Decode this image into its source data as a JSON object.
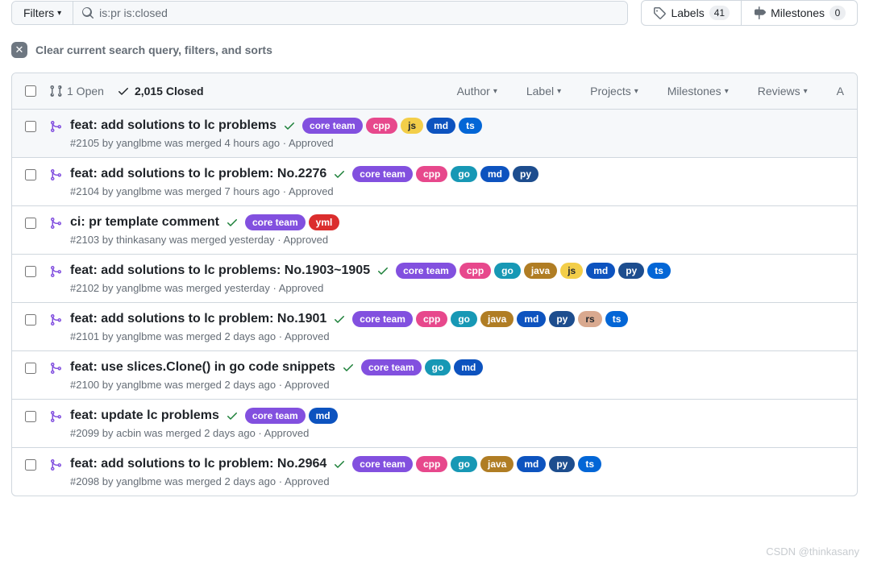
{
  "topbar": {
    "filters_label": "Filters",
    "search_value": "is:pr is:closed",
    "labels_btn": "Labels",
    "labels_count": "41",
    "milestones_btn": "Milestones",
    "milestones_count": "0"
  },
  "clear": {
    "text": "Clear current search query, filters, and sorts"
  },
  "header": {
    "open_count": "1 Open",
    "closed_count": "2,015 Closed",
    "filters": [
      "Author",
      "Label",
      "Projects",
      "Milestones",
      "Reviews",
      "A"
    ]
  },
  "label_colors": {
    "core team": "#8250df",
    "cpp": "#e7488c",
    "js": "#f3ce49",
    "md": "#0d53bf",
    "ts": "#0366d6",
    "go": "#1798b5",
    "py": "#1d4d8e",
    "yml": "#db2d2d",
    "java": "#b07d24",
    "rs": "#d9a98f"
  },
  "rows": [
    {
      "title": "feat: add solutions to lc problems",
      "meta": "#2105 by yanglbme was merged 4 hours ago · Approved",
      "labels": [
        "core team",
        "cpp",
        "js",
        "md",
        "ts"
      ],
      "hover": true
    },
    {
      "title": "feat: add solutions to lc problem: No.2276",
      "meta": "#2104 by yanglbme was merged 7 hours ago · Approved",
      "labels": [
        "core team",
        "cpp",
        "go",
        "md",
        "py"
      ]
    },
    {
      "title": "ci: pr template comment",
      "meta": "#2103 by thinkasany was merged yesterday · Approved",
      "labels": [
        "core team",
        "yml"
      ]
    },
    {
      "title": "feat: add solutions to lc problems: No.1903~1905",
      "meta": "#2102 by yanglbme was merged yesterday · Approved",
      "labels": [
        "core team",
        "cpp",
        "go",
        "java",
        "js",
        "md",
        "py",
        "ts"
      ]
    },
    {
      "title": "feat: add solutions to lc problem: No.1901",
      "meta": "#2101 by yanglbme was merged 2 days ago · Approved",
      "labels": [
        "core team",
        "cpp",
        "go",
        "java",
        "md",
        "py",
        "rs",
        "ts"
      ]
    },
    {
      "title": "feat: use slices.Clone() in go code snippets",
      "meta": "#2100 by yanglbme was merged 2 days ago · Approved",
      "labels": [
        "core team",
        "go",
        "md"
      ]
    },
    {
      "title": "feat: update lc problems",
      "meta": "#2099 by acbin was merged 2 days ago · Approved",
      "labels": [
        "core team",
        "md"
      ]
    },
    {
      "title": "feat: add solutions to lc problem: No.2964",
      "meta": "#2098 by yanglbme was merged 2 days ago · Approved",
      "labels": [
        "core team",
        "cpp",
        "go",
        "java",
        "md",
        "py",
        "ts"
      ]
    }
  ],
  "watermark": "CSDN @thinkasany"
}
